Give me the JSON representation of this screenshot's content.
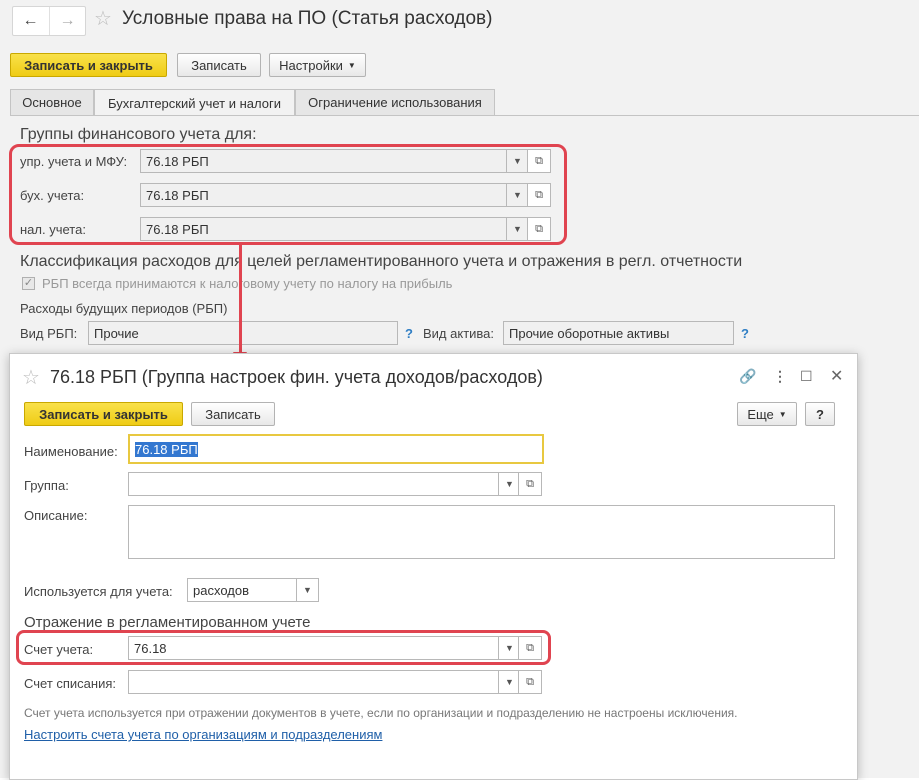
{
  "back": {
    "title": "Условные права на ПО (Статья расходов)",
    "nav": {
      "back": "←",
      "forward": "→"
    },
    "toolbar": {
      "save_close": "Записать и закрыть",
      "save": "Записать",
      "settings": "Настройки"
    },
    "tabs": [
      "Основное",
      "Бухгалтерский учет и налоги",
      "Ограничение использования"
    ],
    "groups_heading": "Группы финансового учета для:",
    "rows": [
      {
        "label": "упр. учета и МФУ:",
        "value": "76.18 РБП"
      },
      {
        "label": "бух. учета:",
        "value": "76.18 РБП"
      },
      {
        "label": "нал. учета:",
        "value": "76.18 РБП"
      }
    ],
    "classif_heading": "Классификация расходов для целей регламентированного учета и отражения в регл. отчетности",
    "checkbox_label": "РБП всегда принимаются к налоговому учету по налогу на прибыль",
    "rbp_heading": "Расходы будущих периодов (РБП)",
    "vid_rbp_label": "Вид РБП:",
    "vid_rbp_value": "Прочие",
    "vid_aktiva_label": "Вид актива:",
    "vid_aktiva_value": "Прочие оборотные активы",
    "help": "?"
  },
  "dialog": {
    "title": "76.18 РБП (Группа настроек фин. учета доходов/расходов)",
    "toolbar": {
      "save_close": "Записать и закрыть",
      "save": "Записать",
      "more": "Еще",
      "help": "?"
    },
    "name_label": "Наименование:",
    "name_value": "76.18 РБП",
    "group_label": "Группа:",
    "group_value": "",
    "description_label": "Описание:",
    "description_value": "",
    "used_for_label": "Используется для учета:",
    "used_for_value": "расходов",
    "reg_heading": "Отражение в регламентированном учете",
    "account_label": "Счет учета:",
    "account_value": "76.18",
    "writeoff_label": "Счет списания:",
    "writeoff_value": "",
    "note": "Счет учета используется при отражении документов в учете, если по организации и подразделению не настроены исключения.",
    "link": "Настроить счета учета по организациям и подразделениям"
  },
  "colors": {
    "accent_yellow": "#efcc15",
    "heading_green": "#2a9a41",
    "highlight_red": "#e04450",
    "link_blue": "#1f5fa8"
  }
}
